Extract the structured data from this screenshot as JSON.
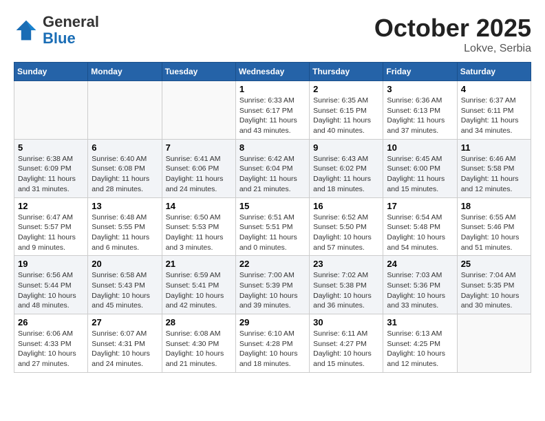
{
  "header": {
    "logo_line1": "General",
    "logo_line2": "Blue",
    "month_title": "October 2025",
    "location": "Lokve, Serbia"
  },
  "weekdays": [
    "Sunday",
    "Monday",
    "Tuesday",
    "Wednesday",
    "Thursday",
    "Friday",
    "Saturday"
  ],
  "weeks": [
    [
      {
        "day": "",
        "info": ""
      },
      {
        "day": "",
        "info": ""
      },
      {
        "day": "",
        "info": ""
      },
      {
        "day": "1",
        "info": "Sunrise: 6:33 AM\nSunset: 6:17 PM\nDaylight: 11 hours\nand 43 minutes."
      },
      {
        "day": "2",
        "info": "Sunrise: 6:35 AM\nSunset: 6:15 PM\nDaylight: 11 hours\nand 40 minutes."
      },
      {
        "day": "3",
        "info": "Sunrise: 6:36 AM\nSunset: 6:13 PM\nDaylight: 11 hours\nand 37 minutes."
      },
      {
        "day": "4",
        "info": "Sunrise: 6:37 AM\nSunset: 6:11 PM\nDaylight: 11 hours\nand 34 minutes."
      }
    ],
    [
      {
        "day": "5",
        "info": "Sunrise: 6:38 AM\nSunset: 6:09 PM\nDaylight: 11 hours\nand 31 minutes."
      },
      {
        "day": "6",
        "info": "Sunrise: 6:40 AM\nSunset: 6:08 PM\nDaylight: 11 hours\nand 28 minutes."
      },
      {
        "day": "7",
        "info": "Sunrise: 6:41 AM\nSunset: 6:06 PM\nDaylight: 11 hours\nand 24 minutes."
      },
      {
        "day": "8",
        "info": "Sunrise: 6:42 AM\nSunset: 6:04 PM\nDaylight: 11 hours\nand 21 minutes."
      },
      {
        "day": "9",
        "info": "Sunrise: 6:43 AM\nSunset: 6:02 PM\nDaylight: 11 hours\nand 18 minutes."
      },
      {
        "day": "10",
        "info": "Sunrise: 6:45 AM\nSunset: 6:00 PM\nDaylight: 11 hours\nand 15 minutes."
      },
      {
        "day": "11",
        "info": "Sunrise: 6:46 AM\nSunset: 5:58 PM\nDaylight: 11 hours\nand 12 minutes."
      }
    ],
    [
      {
        "day": "12",
        "info": "Sunrise: 6:47 AM\nSunset: 5:57 PM\nDaylight: 11 hours\nand 9 minutes."
      },
      {
        "day": "13",
        "info": "Sunrise: 6:48 AM\nSunset: 5:55 PM\nDaylight: 11 hours\nand 6 minutes."
      },
      {
        "day": "14",
        "info": "Sunrise: 6:50 AM\nSunset: 5:53 PM\nDaylight: 11 hours\nand 3 minutes."
      },
      {
        "day": "15",
        "info": "Sunrise: 6:51 AM\nSunset: 5:51 PM\nDaylight: 11 hours\nand 0 minutes."
      },
      {
        "day": "16",
        "info": "Sunrise: 6:52 AM\nSunset: 5:50 PM\nDaylight: 10 hours\nand 57 minutes."
      },
      {
        "day": "17",
        "info": "Sunrise: 6:54 AM\nSunset: 5:48 PM\nDaylight: 10 hours\nand 54 minutes."
      },
      {
        "day": "18",
        "info": "Sunrise: 6:55 AM\nSunset: 5:46 PM\nDaylight: 10 hours\nand 51 minutes."
      }
    ],
    [
      {
        "day": "19",
        "info": "Sunrise: 6:56 AM\nSunset: 5:44 PM\nDaylight: 10 hours\nand 48 minutes."
      },
      {
        "day": "20",
        "info": "Sunrise: 6:58 AM\nSunset: 5:43 PM\nDaylight: 10 hours\nand 45 minutes."
      },
      {
        "day": "21",
        "info": "Sunrise: 6:59 AM\nSunset: 5:41 PM\nDaylight: 10 hours\nand 42 minutes."
      },
      {
        "day": "22",
        "info": "Sunrise: 7:00 AM\nSunset: 5:39 PM\nDaylight: 10 hours\nand 39 minutes."
      },
      {
        "day": "23",
        "info": "Sunrise: 7:02 AM\nSunset: 5:38 PM\nDaylight: 10 hours\nand 36 minutes."
      },
      {
        "day": "24",
        "info": "Sunrise: 7:03 AM\nSunset: 5:36 PM\nDaylight: 10 hours\nand 33 minutes."
      },
      {
        "day": "25",
        "info": "Sunrise: 7:04 AM\nSunset: 5:35 PM\nDaylight: 10 hours\nand 30 minutes."
      }
    ],
    [
      {
        "day": "26",
        "info": "Sunrise: 6:06 AM\nSunset: 4:33 PM\nDaylight: 10 hours\nand 27 minutes."
      },
      {
        "day": "27",
        "info": "Sunrise: 6:07 AM\nSunset: 4:31 PM\nDaylight: 10 hours\nand 24 minutes."
      },
      {
        "day": "28",
        "info": "Sunrise: 6:08 AM\nSunset: 4:30 PM\nDaylight: 10 hours\nand 21 minutes."
      },
      {
        "day": "29",
        "info": "Sunrise: 6:10 AM\nSunset: 4:28 PM\nDaylight: 10 hours\nand 18 minutes."
      },
      {
        "day": "30",
        "info": "Sunrise: 6:11 AM\nSunset: 4:27 PM\nDaylight: 10 hours\nand 15 minutes."
      },
      {
        "day": "31",
        "info": "Sunrise: 6:13 AM\nSunset: 4:25 PM\nDaylight: 10 hours\nand 12 minutes."
      },
      {
        "day": "",
        "info": ""
      }
    ]
  ]
}
